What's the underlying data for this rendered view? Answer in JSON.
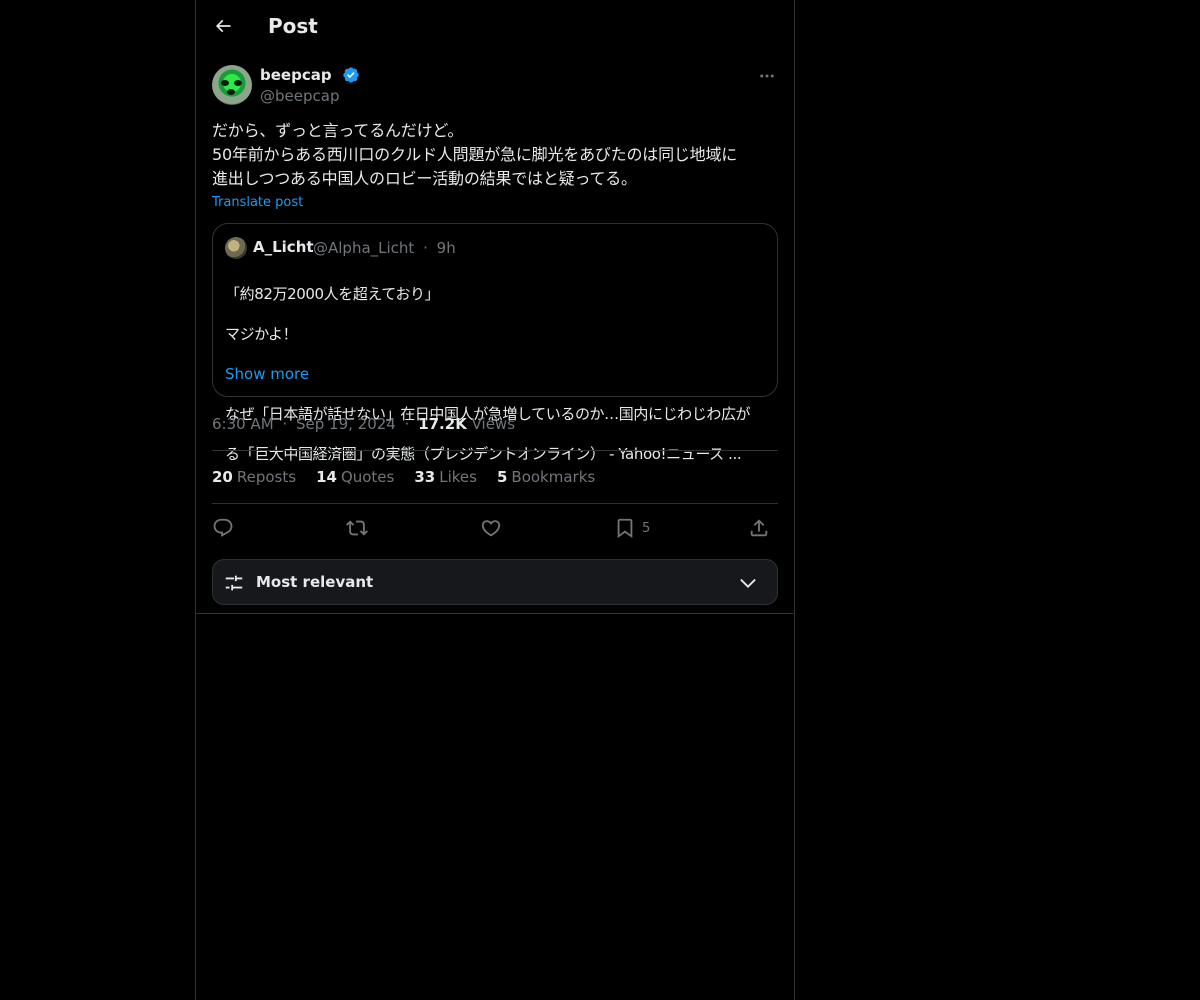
{
  "header": {
    "back_icon": "arrow-left-icon",
    "title": "Post"
  },
  "post": {
    "author": {
      "display_name": "beepcap",
      "handle": "@beepcap",
      "verified": true,
      "avatar_icon": "avatar-image"
    },
    "text": "だから、ずっと言ってるんだけど。\n50年前からある西川口のクルド人問題が急に脚光をあびたのは同じ地域に\n進出しつつある中国人のロビー活動の結果ではと疑ってる。",
    "translate_label": "Translate post",
    "quote": {
      "display_name": "A_Licht",
      "handle": "@Alpha_Licht",
      "separator": "·",
      "time": "9h",
      "lines": [
        "「約82万2000人を超えており」",
        "マジかよ！",
        "",
        "なぜ「日本語が話せない」在日中国人が急増しているのか…国内にじわじわ広が",
        "る「巨大中国経済圏」の実態（プレジデントオンライン） - Yahoo!ニュース ..."
      ],
      "show_more": "Show more"
    },
    "meta": {
      "time": "6:30 AM",
      "date": "Sep 19, 2024",
      "separator": "·",
      "views_count": "17.2K",
      "views_label": "Views"
    },
    "stats": [
      {
        "count": "20",
        "label": "Reposts"
      },
      {
        "count": "14",
        "label": "Quotes"
      },
      {
        "count": "33",
        "label": "Likes"
      },
      {
        "count": "5",
        "label": "Bookmarks"
      }
    ],
    "actions": {
      "reply_icon": "reply-icon",
      "repost_icon": "repost-icon",
      "like_icon": "heart-icon",
      "bookmark_icon": "bookmark-icon",
      "bookmark_count": "5",
      "share_icon": "share-icon"
    }
  },
  "sort": {
    "icon": "sliders-icon",
    "label": "Most relevant",
    "chevron": "chevron-down-icon"
  },
  "colors": {
    "background": "#000000",
    "text": "#e7e9ea",
    "muted": "#71767b",
    "accent": "#1d9bf0",
    "border": "#2f3336"
  }
}
